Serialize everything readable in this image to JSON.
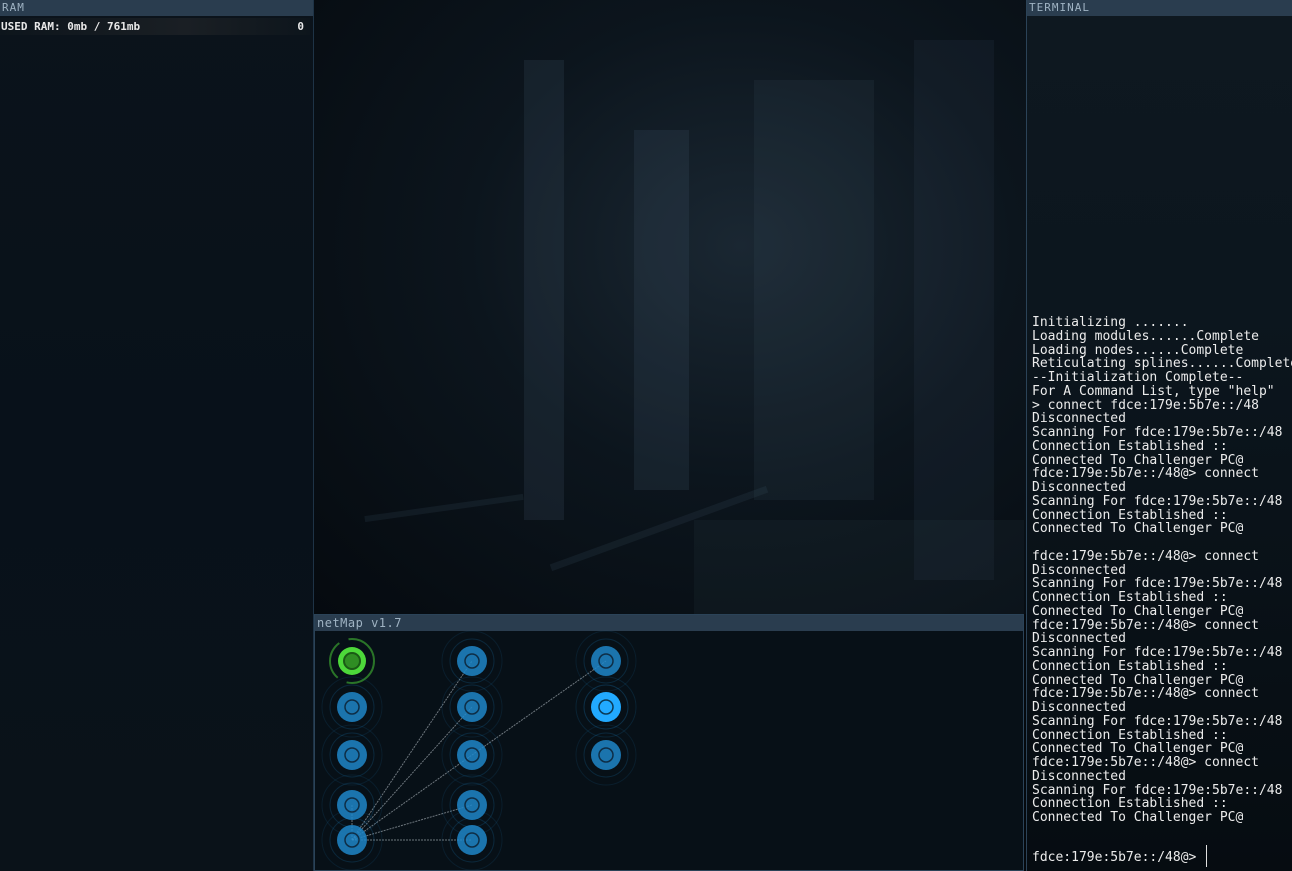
{
  "ram": {
    "header": "RAM",
    "used_label": "USED RAM: 0mb / 761mb",
    "count": "0"
  },
  "netmap": {
    "header": "netMap v1.7",
    "nodes": [
      {
        "id": "home",
        "state": "home"
      },
      {
        "id": "n1",
        "state": "normal"
      },
      {
        "id": "n2",
        "state": "normal"
      },
      {
        "id": "n3",
        "state": "normal"
      },
      {
        "id": "n4",
        "state": "normal"
      },
      {
        "id": "n5",
        "state": "normal"
      },
      {
        "id": "n6",
        "state": "normal"
      },
      {
        "id": "n7",
        "state": "normal"
      },
      {
        "id": "n8",
        "state": "normal"
      },
      {
        "id": "n9",
        "state": "normal"
      },
      {
        "id": "n10",
        "state": "selected"
      },
      {
        "id": "n11",
        "state": "normal"
      }
    ],
    "colors": {
      "node": "#1f86c8",
      "node_selected": "#22aaff",
      "home": "#4dd83a",
      "link": "#9aa3aa"
    }
  },
  "terminal": {
    "header": "TERMINAL",
    "lines": [
      "Initializing .......",
      "Loading modules......Complete",
      "Loading nodes......Complete",
      "Reticulating splines......Complete",
      "--Initialization Complete--",
      "For A Command List, type \"help\"",
      "> connect fdce:179e:5b7e::/48",
      "Disconnected",
      "Scanning For fdce:179e:5b7e::/48",
      "Connection Established ::",
      "Connected To Challenger PC@",
      "fdce:179e:5b7e::/48@> connect",
      "Disconnected",
      "Scanning For fdce:179e:5b7e::/48",
      "Connection Established ::",
      "Connected To Challenger PC@",
      "",
      "fdce:179e:5b7e::/48@> connect",
      "Disconnected",
      "Scanning For fdce:179e:5b7e::/48",
      "Connection Established ::",
      "Connected To Challenger PC@",
      "fdce:179e:5b7e::/48@> connect",
      "Disconnected",
      "Scanning For fdce:179e:5b7e::/48",
      "Connection Established ::",
      "Connected To Challenger PC@",
      "fdce:179e:5b7e::/48@> connect",
      "Disconnected",
      "Scanning For fdce:179e:5b7e::/48",
      "Connection Established ::",
      "Connected To Challenger PC@",
      "fdce:179e:5b7e::/48@> connect",
      "Disconnected",
      "Scanning For fdce:179e:5b7e::/48",
      "Connection Established ::",
      "Connected To Challenger PC@"
    ],
    "prompt": "fdce:179e:5b7e::/48@>"
  }
}
